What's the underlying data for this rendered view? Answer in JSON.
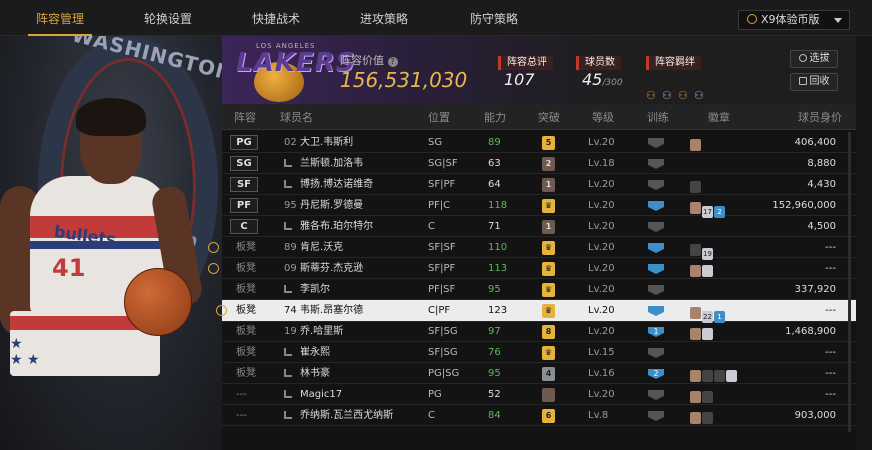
{
  "nav": {
    "tabs": [
      "阵容管理",
      "轮换设置",
      "快捷战术",
      "进攻策略",
      "防守策略"
    ],
    "version_label": "X9体验币版"
  },
  "hero": {
    "team_text": "WASHINGTON",
    "team_text2": "ARDS",
    "jersey_text": "bullets",
    "jersey_number": "41"
  },
  "summary": {
    "team_logo_text": "LAKERS",
    "team_logo_small": "LOS ANGELES",
    "value_label": "阵容价值",
    "value": "156,531,030",
    "rating_label": "阵容总评",
    "rating": "107",
    "count_label": "球员数",
    "count": "45",
    "count_max": "/300",
    "bond_label": "阵容羁绊",
    "btn_filter": "选拔",
    "btn_back": "回收"
  },
  "table": {
    "headers": [
      "阵容",
      "球员名",
      "位置",
      "能力",
      "突破",
      "等级",
      "训练",
      "徽章",
      "球员身价"
    ],
    "rows": [
      {
        "lineup": "PG",
        "num": "02",
        "name": "大卫.韦斯利",
        "pos": "SG",
        "ability": "89",
        "green": true,
        "brk": "5",
        "brk_type": "gold",
        "level": "Lv.20",
        "train": "",
        "train_type": "grey",
        "badges": [
          "b"
        ],
        "badge_nums": [
          ""
        ],
        "price": "406,400",
        "starter": true
      },
      {
        "lineup": "SG",
        "num": "",
        "name": "兰斯顿.加洛韦",
        "pos": "SG|SF",
        "ability": "63",
        "green": false,
        "brk": "2",
        "brk_type": "brown",
        "level": "Lv.18",
        "train": "",
        "train_type": "grey",
        "badges": [],
        "badge_nums": [],
        "price": "8,880",
        "starter": true
      },
      {
        "lineup": "SF",
        "num": "",
        "name": "博扬.博达诺维奇",
        "pos": "SF|PF",
        "ability": "64",
        "green": false,
        "brk": "1",
        "brk_type": "brown",
        "level": "Lv.20",
        "train": "",
        "train_type": "grey",
        "badges": [
          "d"
        ],
        "badge_nums": [
          ""
        ],
        "price": "4,430",
        "starter": true
      },
      {
        "lineup": "PF",
        "num": "95",
        "name": "丹尼斯.罗德曼",
        "pos": "PF|C",
        "ability": "118",
        "green": true,
        "brk": "♛",
        "brk_type": "gold",
        "level": "Lv.20",
        "train": "",
        "train_type": "blue",
        "badges": [
          "b",
          "s",
          "bl"
        ],
        "badge_nums": [
          "",
          "17",
          "2"
        ],
        "price": "152,960,000",
        "starter": true
      },
      {
        "lineup": "C",
        "num": "",
        "name": "雅各布.珀尔特尔",
        "pos": "C",
        "ability": "71",
        "green": false,
        "brk": "1",
        "brk_type": "brown",
        "level": "Lv.20",
        "train": "",
        "train_type": "grey",
        "badges": [],
        "badge_nums": [],
        "price": "4,500",
        "starter": true
      },
      {
        "lineup": "板凳",
        "num": "89",
        "name": "肯尼.沃克",
        "pos": "SF|SF",
        "ability": "110",
        "green": true,
        "brk": "♛",
        "brk_type": "gold",
        "level": "Lv.20",
        "train": "",
        "train_type": "blue",
        "badges": [
          "d",
          "s"
        ],
        "badge_nums": [
          "",
          "19"
        ],
        "price": "---",
        "starter": false,
        "mark": true
      },
      {
        "lineup": "板凳",
        "num": "09",
        "name": "斯蒂芬.杰克逊",
        "pos": "SF|PF",
        "ability": "113",
        "green": true,
        "brk": "♛",
        "brk_type": "gold",
        "level": "Lv.20",
        "train": "",
        "train_type": "blue",
        "badges": [
          "b",
          "s"
        ],
        "badge_nums": [
          "",
          ""
        ],
        "price": "---",
        "starter": false,
        "mark": true
      },
      {
        "lineup": "板凳",
        "num": "",
        "name": "李凯尔",
        "pos": "PF|SF",
        "ability": "95",
        "green": true,
        "brk": "♛",
        "brk_type": "gold",
        "level": "Lv.20",
        "train": "",
        "train_type": "grey",
        "badges": [],
        "badge_nums": [],
        "price": "337,920",
        "starter": false
      },
      {
        "lineup": "板凳",
        "num": "74",
        "name": "韦斯.昂塞尔德",
        "pos": "C|PF",
        "ability": "123",
        "green": false,
        "brk": "♛",
        "brk_type": "gold",
        "level": "Lv.20",
        "train": "",
        "train_type": "blue",
        "badges": [
          "b",
          "s",
          "bl"
        ],
        "badge_nums": [
          "",
          "22",
          "1"
        ],
        "price": "---",
        "starter": false,
        "mark": true,
        "highlight": true
      },
      {
        "lineup": "板凳",
        "num": "19",
        "name": "乔.哈里斯",
        "pos": "SF|SG",
        "ability": "97",
        "green": true,
        "brk": "8",
        "brk_type": "gold",
        "level": "Lv.20",
        "train": "1",
        "train_type": "blue",
        "badges": [
          "b",
          "s"
        ],
        "badge_nums": [
          "",
          ""
        ],
        "price": "1,468,900",
        "starter": false
      },
      {
        "lineup": "板凳",
        "num": "",
        "name": "崔永熙",
        "pos": "SF|SG",
        "ability": "76",
        "green": true,
        "brk": "♛",
        "brk_type": "gold",
        "level": "Lv.15",
        "train": "",
        "train_type": "grey",
        "badges": [],
        "badge_nums": [],
        "price": "---",
        "starter": false
      },
      {
        "lineup": "板凳",
        "num": "",
        "name": "林书豪",
        "pos": "PG|SG",
        "ability": "95",
        "green": true,
        "brk": "4",
        "brk_type": "silver",
        "level": "Lv.16",
        "train": "2",
        "train_type": "blue",
        "badges": [
          "b",
          "d",
          "d",
          "s"
        ],
        "badge_nums": [
          "",
          "",
          "",
          ""
        ],
        "price": "---",
        "starter": false
      },
      {
        "lineup": "---",
        "num": "",
        "name": "Magic17",
        "pos": "PG",
        "ability": "52",
        "green": false,
        "brk": "",
        "brk_type": "brown",
        "level": "Lv.20",
        "train": "",
        "train_type": "grey",
        "badges": [
          "b",
          "d"
        ],
        "badge_nums": [
          "",
          ""
        ],
        "price": "---",
        "starter": false
      },
      {
        "lineup": "---",
        "num": "",
        "name": "乔纳斯.瓦兰西尤纳斯",
        "pos": "C",
        "ability": "84",
        "green": true,
        "brk": "6",
        "brk_type": "gold",
        "level": "Lv.8",
        "train": "",
        "train_type": "grey",
        "badges": [
          "b",
          "d"
        ],
        "badge_nums": [
          "",
          ""
        ],
        "price": "903,000",
        "starter": false
      }
    ]
  }
}
